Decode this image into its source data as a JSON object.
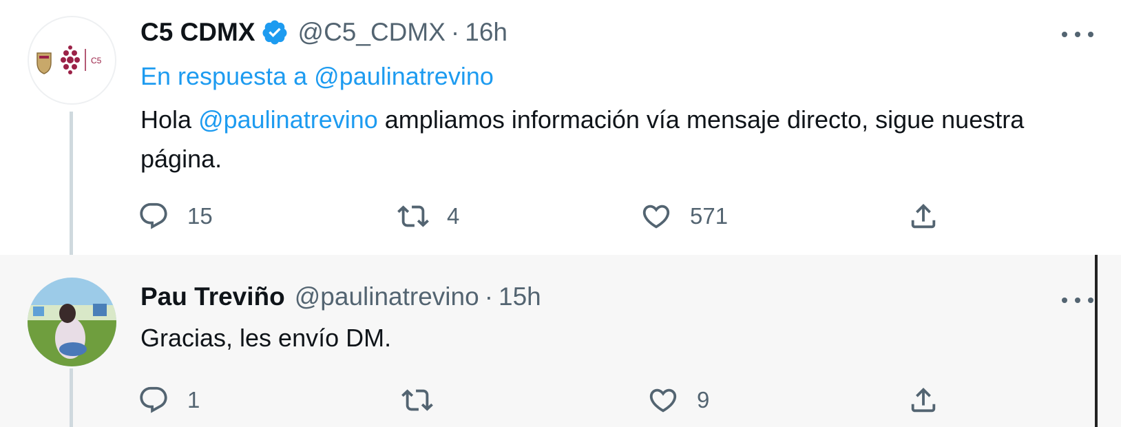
{
  "tweets": [
    {
      "display_name": "C5 CDMX",
      "verified": true,
      "handle": "@C5_CDMX",
      "separator": "·",
      "time": "16h",
      "reply_prefix": "En respuesta a",
      "reply_to": "@paulinatrevino",
      "text_before": "Hola",
      "mention": "@paulinatrevino",
      "text_after": "ampliamos información vía mensaje directo, sigue nuestra página.",
      "actions": {
        "reply": "15",
        "retweet": "4",
        "like": "571"
      },
      "avatar_label": "C5"
    },
    {
      "display_name": "Pau Treviño",
      "verified": false,
      "handle": "@paulinatrevino",
      "separator": "·",
      "time": "15h",
      "text": "Gracias, les envío DM.",
      "actions": {
        "reply": "1",
        "retweet": "",
        "like": "9"
      }
    }
  ],
  "colors": {
    "link": "#1d9bf0",
    "text": "#0f1419",
    "muted": "#536471",
    "thread_line": "#cfd9de",
    "c5_brand": "#9b2247"
  },
  "icons": {
    "reply": "reply-icon",
    "retweet": "retweet-icon",
    "like": "heart-icon",
    "share": "share-icon",
    "more": "more-icon",
    "verified": "verified-badge-icon"
  }
}
